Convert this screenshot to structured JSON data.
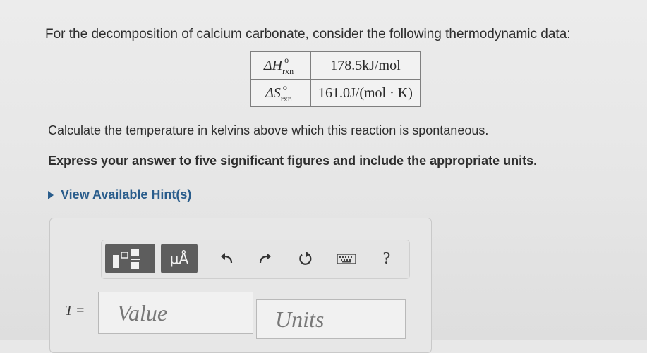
{
  "problem": {
    "intro": "For the decomposition of calcium carbonate, consider the following thermodynamic data:",
    "table": [
      {
        "symbol_main": "ΔH",
        "symbol_sup": "o",
        "symbol_sub": "rxn",
        "value": "178.5kJ/mol"
      },
      {
        "symbol_main": "ΔS",
        "symbol_sup": "o",
        "symbol_sub": "rxn",
        "value": "161.0J/(mol · K)"
      }
    ],
    "question": "Calculate the temperature in kelvins above which this reaction is spontaneous.",
    "instruction": "Express your answer to five significant figures and include the appropriate units."
  },
  "hints": {
    "label": "View Available Hint(s)"
  },
  "toolbar": {
    "units_button": "μÅ",
    "help_label": "?",
    "icons": [
      "templates-icon",
      "units-icon",
      "undo-icon",
      "redo-icon",
      "reset-icon",
      "keyboard-icon",
      "help-icon"
    ]
  },
  "answer": {
    "variable": "T",
    "equals": "=",
    "value_placeholder": "Value",
    "units_placeholder": "Units"
  },
  "colors": {
    "link": "#2a5d8c",
    "button_dark": "#5d5d5d",
    "background": "#e8e8e8"
  }
}
